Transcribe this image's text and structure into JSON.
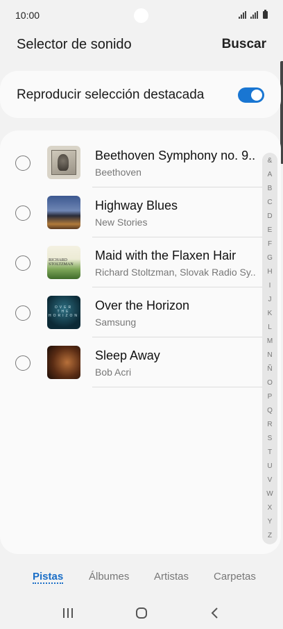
{
  "status": {
    "time": "10:00"
  },
  "header": {
    "title": "Selector de sonido",
    "search_label": "Buscar"
  },
  "highlight": {
    "label": "Reproducir selección destacada",
    "toggle_on": true
  },
  "tracks": [
    {
      "title": "Beethoven Symphony no. 9..",
      "artist": "Beethoven",
      "thumb": "beethoven-portrait"
    },
    {
      "title": "Highway Blues",
      "artist": "New Stories",
      "thumb": "highway-blues-cover"
    },
    {
      "title": "Maid with the Flaxen Hair",
      "artist": "Richard Stoltzman, Slovak Radio Sy..",
      "thumb": "richard-stoltzman-cover",
      "thumb_text": "RICHARD STOLTZMAN"
    },
    {
      "title": "Over the Horizon",
      "artist": "Samsung",
      "thumb": "over-the-horizon-cover",
      "thumb_text": "OVER THE HORIZON"
    },
    {
      "title": "Sleep Away",
      "artist": "Bob Acri",
      "thumb": "sleep-away-cover"
    }
  ],
  "index_letters": [
    "&",
    "A",
    "B",
    "C",
    "D",
    "E",
    "F",
    "G",
    "H",
    "I",
    "J",
    "K",
    "L",
    "M",
    "N",
    "Ñ",
    "O",
    "P",
    "Q",
    "R",
    "S",
    "T",
    "U",
    "V",
    "W",
    "X",
    "Y",
    "Z"
  ],
  "tabs": [
    {
      "label": "Pistas",
      "active": true
    },
    {
      "label": "Álbumes",
      "active": false
    },
    {
      "label": "Artistas",
      "active": false
    },
    {
      "label": "Carpetas",
      "active": false
    }
  ],
  "navbar": {
    "icons": [
      "recent-apps-icon",
      "home-icon",
      "back-icon"
    ]
  },
  "colors": {
    "accent": "#1976d2",
    "background": "#f2f2f2",
    "card": "#fafafa"
  }
}
